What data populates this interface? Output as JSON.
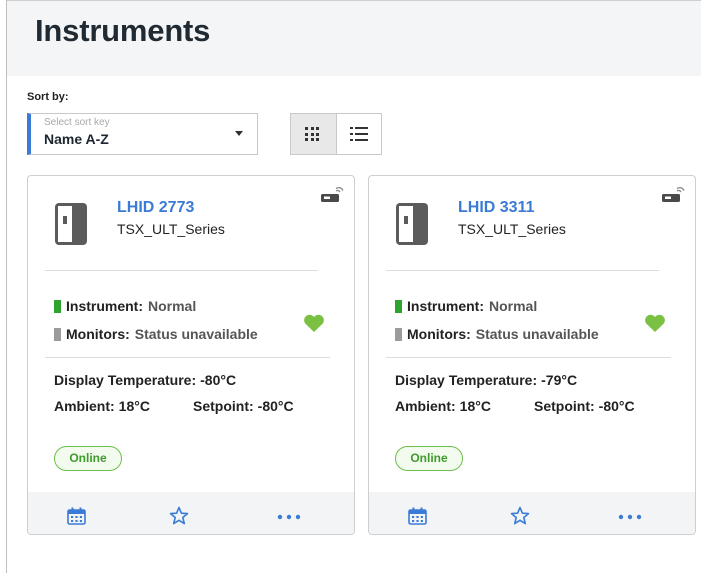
{
  "page": {
    "title": "Instruments"
  },
  "sort": {
    "label": "Sort by:",
    "placeholder": "Select sort key",
    "value": "Name A-Z"
  },
  "view_modes": {
    "active": "grid"
  },
  "colors": {
    "accent": "#3a7bd5",
    "status_normal": "#2ea32e",
    "status_unavailable": "#9b9b9b",
    "heart": "#7ac143",
    "online": "#6cbf4a"
  },
  "cards": [
    {
      "id": "LHID 2773",
      "series": "TSX_ULT_Series",
      "instrument_label": "Instrument:",
      "instrument_status": "Normal",
      "monitors_label": "Monitors:",
      "monitors_status": "Status unavailable",
      "display_temp_label": "Display Temperature:",
      "display_temp_value": "-80°C",
      "ambient_label": "Ambient:",
      "ambient_value": "18°C",
      "setpoint_label": "Setpoint:",
      "setpoint_value": "-80°C",
      "connection": "Online",
      "footer_more": "•••"
    },
    {
      "id": "LHID 3311",
      "series": "TSX_ULT_Series",
      "instrument_label": "Instrument:",
      "instrument_status": "Normal",
      "monitors_label": "Monitors:",
      "monitors_status": "Status unavailable",
      "display_temp_label": "Display Temperature:",
      "display_temp_value": "-79°C",
      "ambient_label": "Ambient:",
      "ambient_value": "18°C",
      "setpoint_label": "Setpoint:",
      "setpoint_value": "-80°C",
      "connection": "Online",
      "footer_more": "•••"
    }
  ],
  "icons": {
    "device": "freezer-icon",
    "connectivity": "wireless-device-icon",
    "health": "heart-icon",
    "calendar": "calendar-icon",
    "favorite": "star-icon",
    "more": "more-options-icon"
  }
}
